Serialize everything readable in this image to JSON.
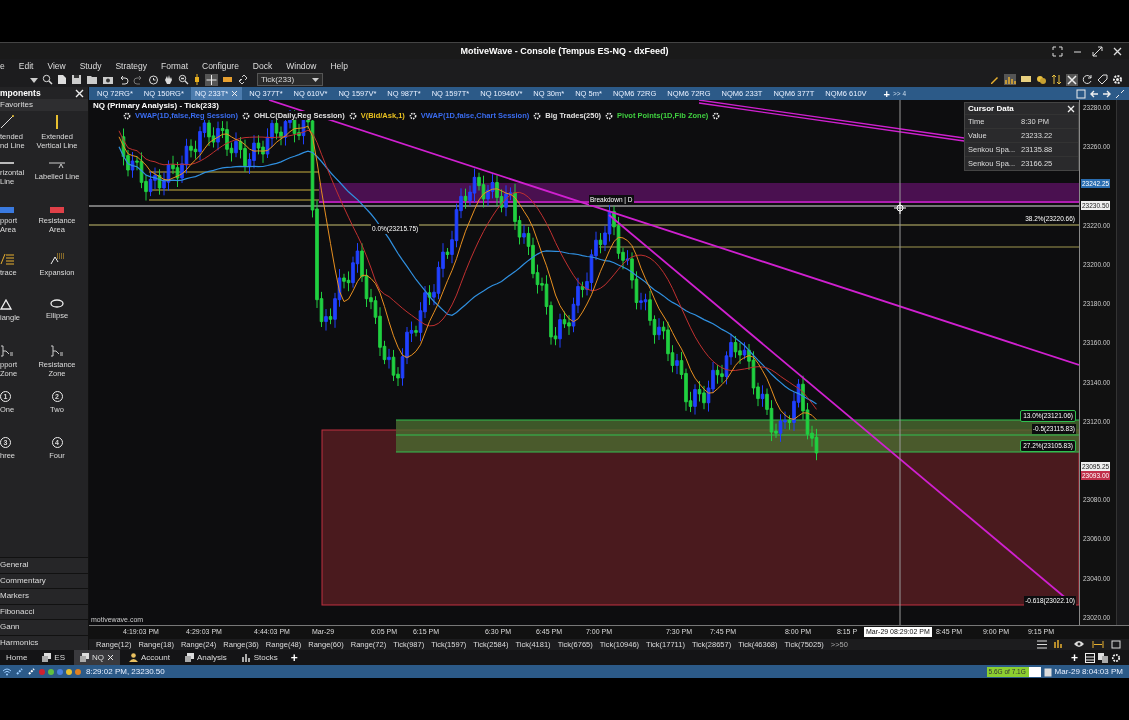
{
  "window": {
    "title": "MotiveWave - Console (Tempus ES-NQ - dxFeed)"
  },
  "menu": [
    "e",
    "Edit",
    "View",
    "Study",
    "Strategy",
    "Format",
    "Configure",
    "Dock",
    "Window",
    "Help"
  ],
  "toolbar": {
    "bar_size": "Tick(233)"
  },
  "chart_tabs": [
    {
      "label": "NQ 72RG*",
      "selected": false
    },
    {
      "label": "NQ 150RG*",
      "selected": false
    },
    {
      "label": "NQ 233T*",
      "selected": true
    },
    {
      "label": "NQ 377T*",
      "selected": false
    },
    {
      "label": "NQ 610V*",
      "selected": false
    },
    {
      "label": "NQ 1597V*",
      "selected": false
    },
    {
      "label": "NQ 987T*",
      "selected": false
    },
    {
      "label": "NQ 1597T*",
      "selected": false
    },
    {
      "label": "NQ 10946V*",
      "selected": false
    },
    {
      "label": "NQ 30m*",
      "selected": false
    },
    {
      "label": "NQ 5m*",
      "selected": false
    },
    {
      "label": "NQM6 72RG",
      "selected": false
    },
    {
      "label": "NQM6 72RG",
      "selected": false
    },
    {
      "label": "NQM6 233T",
      "selected": false
    },
    {
      "label": "NQM6 377T",
      "selected": false
    },
    {
      "label": "NQM6 610V",
      "selected": false
    }
  ],
  "chart_tab_add": "+",
  "chart_tab_overflow": ">> 4",
  "components": {
    "title": "mponents",
    "favorites": "Favorites",
    "tools": [
      {
        "label": "tended\nnd Line",
        "kind": "trendline"
      },
      {
        "label": "Extended Vertical Line",
        "kind": "vline"
      },
      {
        "label": "rizontal\nLine",
        "kind": "hline"
      },
      {
        "label": "Labelled Line",
        "kind": "labelled"
      },
      {
        "label": "pport\nArea",
        "kind": "support"
      },
      {
        "label": "Resistance Area",
        "kind": "resistance"
      },
      {
        "label": "trace",
        "kind": "retrace"
      },
      {
        "label": "Expansion",
        "kind": "expansion"
      },
      {
        "label": "iangle",
        "kind": "triangle"
      },
      {
        "label": "Ellipse",
        "kind": "ellipse"
      },
      {
        "label": "pport\nZone",
        "kind": "zone"
      },
      {
        "label": "Resistance Zone",
        "kind": "zone"
      },
      {
        "label": "One",
        "kind": "number",
        "glyph": "1"
      },
      {
        "label": "Two",
        "kind": "number",
        "glyph": "2"
      },
      {
        "label": "hree",
        "kind": "number",
        "glyph": "3"
      },
      {
        "label": "Four",
        "kind": "number",
        "glyph": "4"
      }
    ],
    "categories": [
      "General",
      "Commentary",
      "Markers",
      "Fibonacci",
      "Gann",
      "Harmonics"
    ]
  },
  "chart": {
    "title": "NQ (Primary Analysis) - Tick(233)",
    "studies": [
      {
        "label": "VWAP(1D,false,Reg Session)",
        "color": "#3a6cf0"
      },
      {
        "label": "OHLC(Daily,Reg Session)",
        "color": "#e0e0e0"
      },
      {
        "label": "V(Bid/Ask,1)",
        "color": "#e8c020"
      },
      {
        "label": "VWAP(1D,false,Chart Session)",
        "color": "#3a6cf0"
      },
      {
        "label": "Big Trades(250)",
        "color": "#e0e0e0"
      },
      {
        "label": "Pivot Points(1D,Fib Zone)",
        "color": "#40d040"
      }
    ],
    "annotations": [
      {
        "text": "Breakdown | D",
        "kind": "plain"
      },
      {
        "text": "0.0%(23215.75)",
        "kind": "plain"
      },
      {
        "text": "38.2%(23220.66)",
        "kind": "plain"
      },
      {
        "text": "13.0%(23121.06)",
        "kind": "boxed"
      },
      {
        "text": "-0.5(23115.83)",
        "kind": "plain"
      },
      {
        "text": "27.2%(23105.83)",
        "kind": "boxed"
      },
      {
        "text": "-0.618(23022.10)",
        "kind": "plain"
      }
    ],
    "watermark": "motivewave.com",
    "cursor_data": {
      "title": "Cursor Data",
      "rows": [
        {
          "label": "Time",
          "value": "8:30 PM"
        },
        {
          "label": "Value",
          "value": "23233.22"
        },
        {
          "label": "Senkou Spa...",
          "value": "23135.88"
        },
        {
          "label": "Senkou Spa...",
          "value": "23166.25"
        }
      ]
    },
    "price_axis": [
      "23280.00",
      "23260.00",
      "23220.00",
      "23200.00",
      "23180.00",
      "23160.00",
      "23140.00",
      "23120.00",
      "23080.00",
      "23060.00",
      "23040.00",
      "23020.00"
    ],
    "price_markers": [
      {
        "text": "23242.25",
        "color": "#2a6db0"
      },
      {
        "text": "23230.50",
        "color": "#f0f0f0"
      },
      {
        "text": "23095.25",
        "color": "#f0f0f0"
      },
      {
        "text": "23093.00",
        "color": "#c0304a"
      }
    ],
    "time_axis": [
      "4:19:03 PM",
      "4:29:03 PM",
      "4:44:03 PM",
      "Mar-29",
      "6:05 PM",
      "6:15 PM",
      "6:30 PM",
      "6:45 PM",
      "7:00 PM",
      "7:30 PM",
      "7:45 PM",
      "8:00 PM",
      "8:15 P",
      "8:45 PM",
      "9:00 PM",
      "9:15 PM"
    ],
    "cursor_time": "Mar-29 08:29:02 PM"
  },
  "bar_sizes": [
    "Range(12)",
    "Range(18)",
    "Range(24)",
    "Range(36)",
    "Range(48)",
    "Range(60)",
    "Range(72)",
    "Tick(987)",
    "Tick(1597)",
    "Tick(2584)",
    "Tick(4181)",
    "Tick(6765)",
    "Tick(10946)",
    "Tick(17711)",
    "Tick(28657)",
    "Tick(46368)",
    "Tick(75025)"
  ],
  "bar_sizes_overflow": ">>50",
  "bottom_tabs": [
    {
      "label": "Home",
      "kind": "home",
      "selected": false
    },
    {
      "label": "ES",
      "kind": "layout",
      "selected": false
    },
    {
      "label": "NQ",
      "kind": "layout",
      "selected": true
    },
    {
      "label": "Account",
      "kind": "account",
      "selected": false
    },
    {
      "label": "Analysis",
      "kind": "layout",
      "selected": false
    },
    {
      "label": "Stocks",
      "kind": "chart",
      "selected": false
    }
  ],
  "bottom_tab_add": "+",
  "status": {
    "dots": [
      {
        "color": "#d02030"
      },
      {
        "color": "#60c040"
      },
      {
        "color": "#4a80e0"
      },
      {
        "color": "#e8c030"
      },
      {
        "color": "#e08020"
      }
    ],
    "readout": "8:29:02 PM, 23230.50",
    "memory": {
      "text": "5.6G of 7.1G",
      "level": 0.79
    },
    "clock": "Mar-29 8:04:03 PM"
  }
}
